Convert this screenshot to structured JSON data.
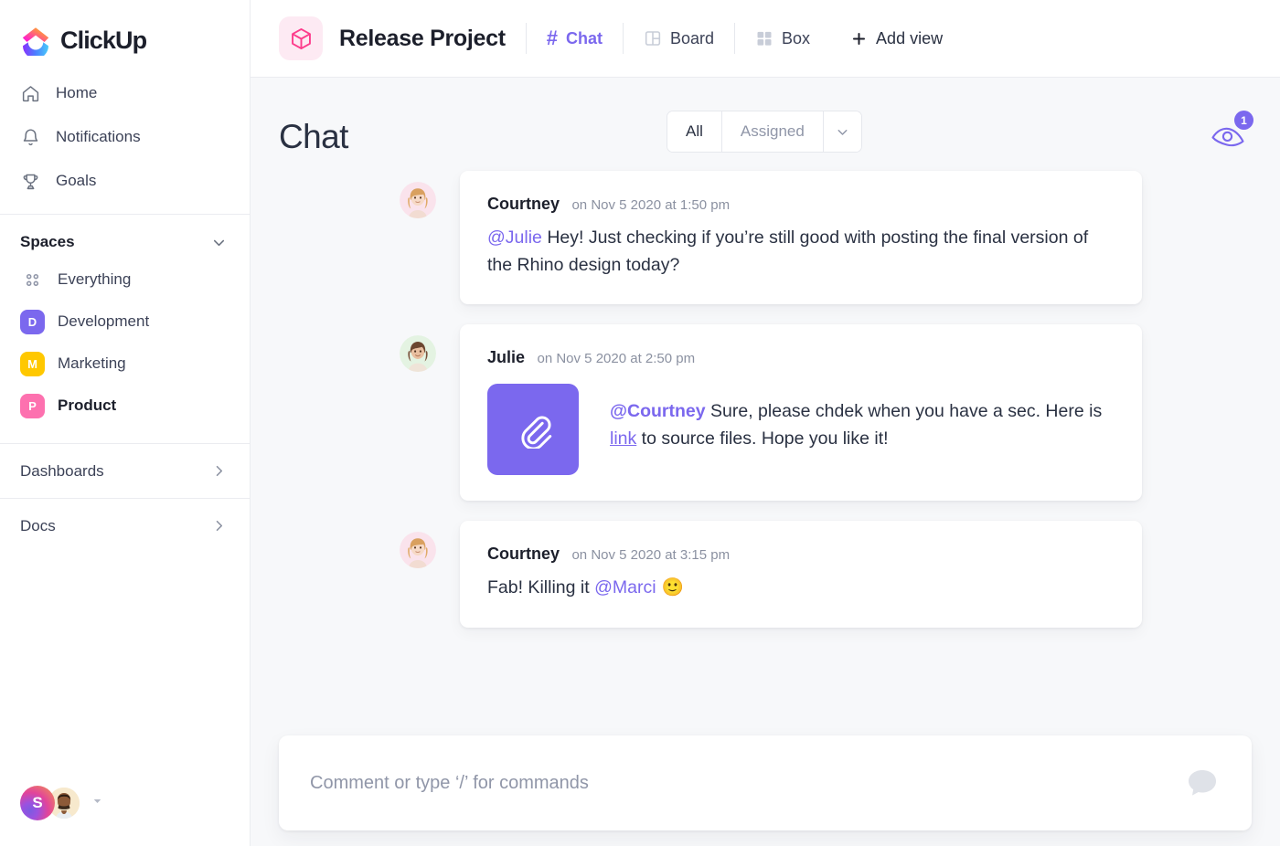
{
  "brand": {
    "name": "ClickUp",
    "accent": "#7b68ee"
  },
  "sidebar": {
    "nav": [
      {
        "label": "Home",
        "icon": "home-icon"
      },
      {
        "label": "Notifications",
        "icon": "bell-icon"
      },
      {
        "label": "Goals",
        "icon": "trophy-icon"
      }
    ],
    "spaces_title": "Spaces",
    "spaces": [
      {
        "label": "Everything",
        "initial": "",
        "color": "",
        "active": false,
        "icon": "grid-dots-icon"
      },
      {
        "label": "Development",
        "initial": "D",
        "color": "#7b68ee",
        "active": false
      },
      {
        "label": "Marketing",
        "initial": "M",
        "color": "#ffc800",
        "active": false
      },
      {
        "label": "Product",
        "initial": "P",
        "color": "#fd71af",
        "active": true
      }
    ],
    "sections": [
      {
        "label": "Dashboards"
      },
      {
        "label": "Docs"
      }
    ],
    "user": {
      "workspace_initial": "S"
    }
  },
  "topbar": {
    "project_title": "Release Project",
    "project_icon": "cube-icon",
    "tabs": [
      {
        "label": "Chat",
        "icon": "hash-icon",
        "active": true
      },
      {
        "label": "Board",
        "icon": "board-icon",
        "active": false
      },
      {
        "label": "Box",
        "icon": "box-grid-icon",
        "active": false
      },
      {
        "label": "Add view",
        "icon": "plus-icon",
        "active": false
      }
    ]
  },
  "page": {
    "title": "Chat",
    "filter": {
      "all_label": "All",
      "assigned_label": "Assigned"
    },
    "watchers": {
      "count": "1",
      "icon": "eye-icon"
    }
  },
  "messages": [
    {
      "author": "Courtney",
      "time": "on Nov 5 2020 at 1:50 pm",
      "avatar_bg": "#fae3ec",
      "type": "text",
      "mention": "@Julie",
      "text": " Hey! Just checking if you’re still good with posting the final version of the Rhino design today?"
    },
    {
      "author": "Julie",
      "time": "on Nov 5 2020 at 2:50 pm",
      "avatar_bg": "#e4f3e2",
      "type": "attachment",
      "attachment_icon": "paperclip-icon",
      "mention": "@Courtney",
      "text_before_link": " Sure, please chdek when you have a sec. Here is ",
      "link_label": "link",
      "text_after_link": " to source files. Hope you like it!"
    },
    {
      "author": "Courtney",
      "time": "on Nov 5 2020 at 3:15 pm",
      "avatar_bg": "#fae3ec",
      "type": "text_trailing_mention",
      "text_before": "Fab! Killing it ",
      "mention": "@Marci",
      "emoji": "🙂"
    }
  ],
  "composer": {
    "placeholder": "Comment or type ‘/’ for commands",
    "value": "",
    "icon": "comment-bubble-icon"
  }
}
